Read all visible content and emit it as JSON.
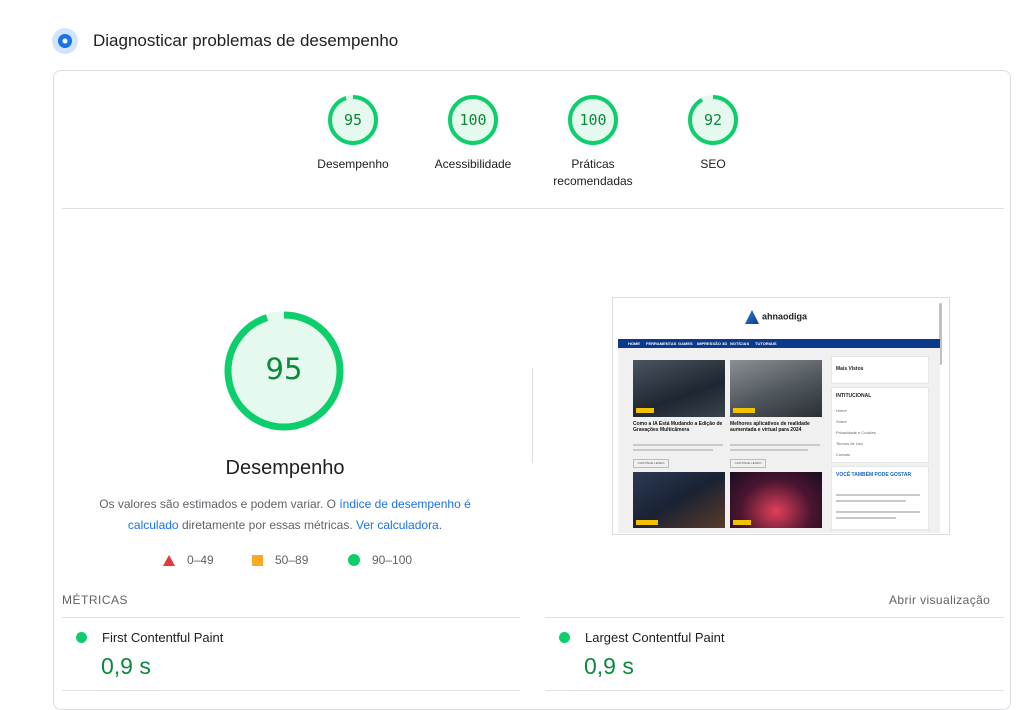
{
  "header": {
    "title": "Diagnosticar problemas de desempenho",
    "icon": "lighthouse-icon"
  },
  "summary_gauges": [
    {
      "score": 95,
      "label": "Desempenho"
    },
    {
      "score": 100,
      "label": "Acessibilidade"
    },
    {
      "score": 100,
      "label_line1": "Práticas",
      "label_line2": "recomendadas"
    },
    {
      "score": 92,
      "label": "SEO"
    }
  ],
  "performance": {
    "score": 95,
    "label": "Desempenho",
    "note_part1": "Os valores são estimados e podem variar. O ",
    "note_link1": "índice de desempenho é calculado",
    "note_part2": " diretamente por essas métricas. ",
    "note_link2": "Ver calculadora",
    "note_part3": "."
  },
  "legend": [
    {
      "range": "0–49",
      "shape": "triangle",
      "color": "#e53935"
    },
    {
      "range": "50–89",
      "shape": "square",
      "color": "#ffa726"
    },
    {
      "range": "90–100",
      "shape": "circle",
      "color": "#0cce6b"
    }
  ],
  "preview": {
    "site_name": "ahnaodiga",
    "nav": [
      "HOME",
      "FERRAMENTAS",
      "GAMES",
      "IMPRESSÃO 3D",
      "NOTÍCIAS",
      "TUTORIAIS"
    ],
    "posts": [
      {
        "title": "Como a IA Está Mudando a Edição de Gravações Multicâmera",
        "badge": "Notícias"
      },
      {
        "title": "Melhores aplicativos de realidade aumentada e virtual para 2024",
        "badge": "Ferramentas"
      }
    ],
    "continue_label": "CONTINUE LENDO",
    "sidebar": {
      "most_viewed": "Mais Vistos",
      "institutional": "INTITUCIONAL",
      "links": [
        "Home",
        "Sobre",
        "Privacidade e Cookies",
        "Termos de Uso",
        "Contato"
      ],
      "also_like": "VOCÊ TAMBÉM PODE GOSTAR"
    }
  },
  "metrics": {
    "title": "MÉTRICAS",
    "toggle_label": "Abrir visualização",
    "items": [
      {
        "name": "First Contentful Paint",
        "value": "0,9 s",
        "status_color": "#0cce6b"
      },
      {
        "name": "Largest Contentful Paint",
        "value": "0,9 s",
        "status_color": "#0cce6b"
      }
    ]
  },
  "colors": {
    "pass_stroke": "#0cce6b",
    "pass_text": "#0a8a3a",
    "pass_fill": "#e6f9ee",
    "link": "#1a73e8"
  }
}
